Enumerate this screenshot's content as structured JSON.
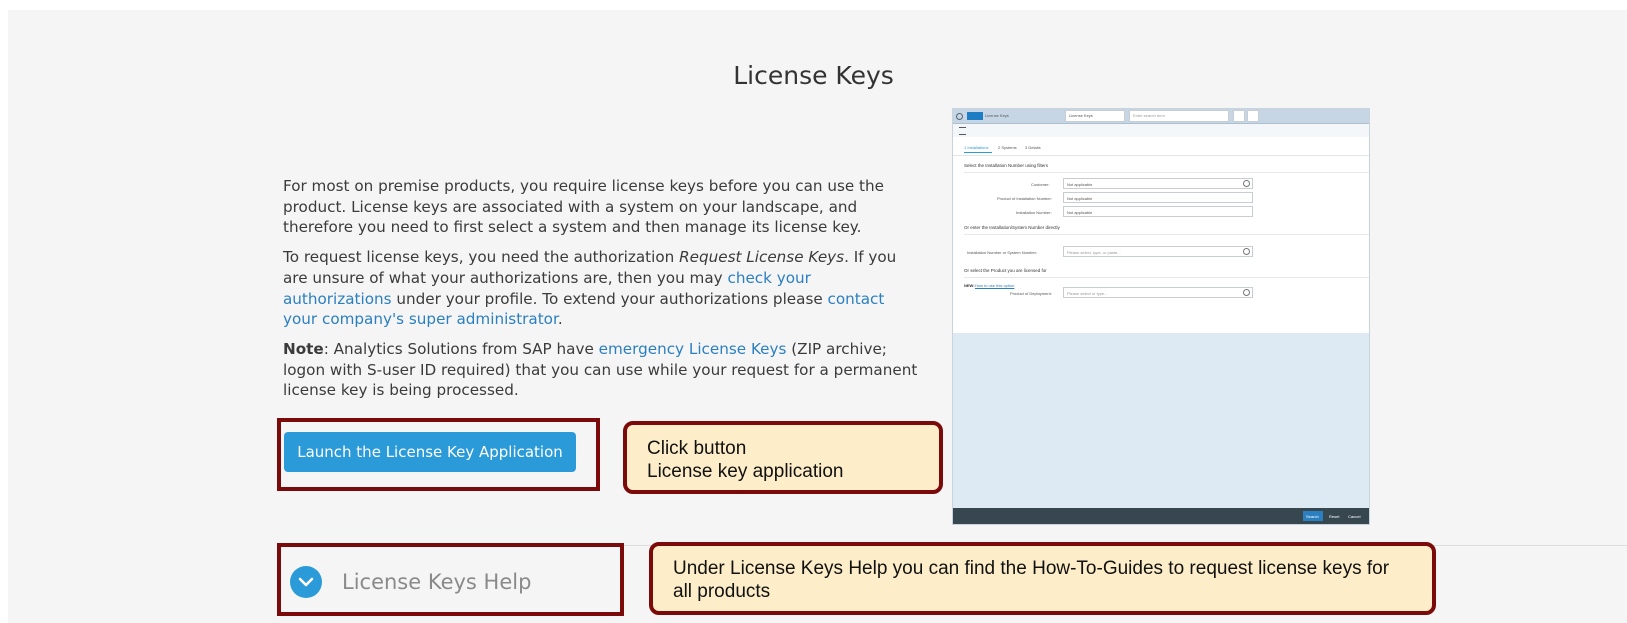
{
  "page": {
    "title": "License Keys"
  },
  "intro": {
    "p1": "For most on premise products, you require license keys before you can use the product. License keys are associated with a system on your landscape, and therefore you need to first select a system and then manage its license key.",
    "p2_a": "To request license keys, you need the authorization ",
    "p2_em": "Request License Keys",
    "p2_b": ". If you are unsure of what your authorizations are, then you may ",
    "p2_link1": "check your authorizations",
    "p2_c": " under your profile. To extend your authorizations please ",
    "p2_link2": "contact your company's super administrator",
    "p2_d": ".",
    "p3_bold": "Note",
    "p3_a": ": Analytics Solutions from SAP have ",
    "p3_link": "emergency License Keys",
    "p3_b": " (ZIP archive; logon with S-user ID required) that you can use while your request for a permanent license key is being processed."
  },
  "launch_button": {
    "label": "Launch the License Key Application"
  },
  "callouts": {
    "launch": {
      "line1": "Click button",
      "line2": "License key application"
    },
    "help": {
      "text": "Under License Keys Help you can find the How-To-Guides to request license keys for all products"
    }
  },
  "help_section": {
    "label": "License Keys Help",
    "icon": "chevron-down-icon"
  },
  "screenshot": {
    "app_name": "License Keys",
    "dropdown": "License Keys",
    "search_placeholder": "Enter search term",
    "steps": [
      "1 Installations",
      "2 Systems",
      "3 Details"
    ],
    "section1": "Select the Installation Number using filters",
    "fields": [
      {
        "label": "Customer:",
        "value": "Not applicable"
      },
      {
        "label": "Product of Installation Number:",
        "value": "Not applicable"
      },
      {
        "label": "Installation Number:",
        "value": "Not applicable"
      }
    ],
    "section2": "Or enter the Installation/System Number directly",
    "direct_label": "Installation Number or System Number:",
    "direct_placeholder": "Please select, type, or paste...",
    "section3": "Or select the Product you are licensed for",
    "new_label": "NEW:",
    "new_link": "How to use this option",
    "product_label": "Product of Deployment:",
    "product_placeholder": "Please select or type...",
    "footer_buttons": [
      "Search",
      "Reset",
      "Cancel"
    ]
  },
  "colors": {
    "accent": "#2a9ad8",
    "highlight_border": "#7b0a0a",
    "callout_bg": "#fdeec9",
    "link": "#2b7fc1"
  }
}
